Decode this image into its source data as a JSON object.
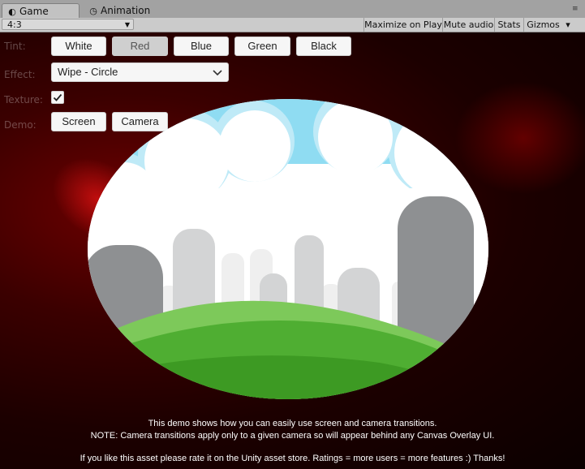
{
  "tabs": {
    "game": {
      "label": "Game",
      "icon": "game-view-icon"
    },
    "animation": {
      "label": "Animation",
      "icon": "clock-icon"
    },
    "menu_icon": "tab-menu-icon"
  },
  "toolbar": {
    "aspect": "4:3",
    "maximize": "Maximize on Play",
    "mute": "Mute audio",
    "stats": "Stats",
    "gizmos": "Gizmos",
    "gizmos_arrow": "▾"
  },
  "controls": {
    "tint_label": "Tint:",
    "tint_buttons": [
      "White",
      "Red",
      "Blue",
      "Green",
      "Black"
    ],
    "tint_selected": "Red",
    "effect_label": "Effect:",
    "effect_value": "Wipe - Circle",
    "texture_label": "Texture:",
    "texture_checked": true,
    "demo_label": "Demo:",
    "demo_buttons": [
      "Screen",
      "Camera"
    ]
  },
  "footer": {
    "line1": "This demo shows how you can easily use screen and camera transitions.",
    "line2": "NOTE: Camera transitions apply only to a given camera so will appear behind any Canvas Overlay UI.",
    "line3": "If you like this asset please rate it on the Unity asset store. Ratings = more users = more features :) Thanks!"
  },
  "colors": {
    "background": "#1a0000",
    "sky": "#8fdcf2",
    "cloud": "#ffffff",
    "building_dark": "#8e9092",
    "building_light": "#d3d4d5",
    "grass_light": "#7dc95a",
    "grass": "#4fae32",
    "grass_dark": "#3d9a23"
  }
}
